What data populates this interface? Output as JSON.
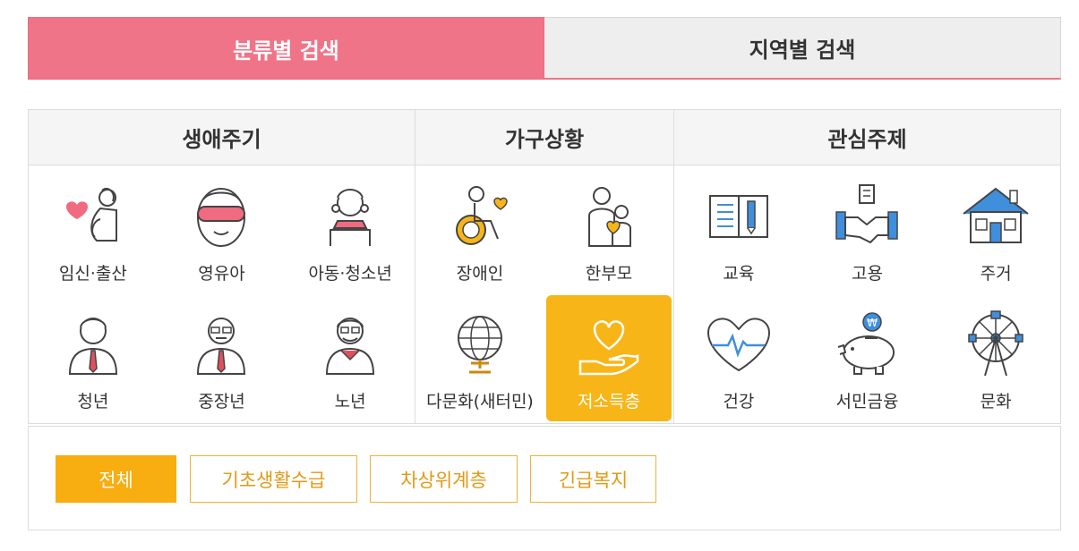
{
  "tabs": [
    {
      "label": "분류별 검색",
      "active": true
    },
    {
      "label": "지역별 검색",
      "active": false
    }
  ],
  "groups": [
    {
      "title": "생애주기",
      "items": [
        {
          "label": "임신·출산",
          "icon": "pregnant-woman-icon"
        },
        {
          "label": "영유아",
          "icon": "infant-icon"
        },
        {
          "label": "아동·청소년",
          "icon": "child-icon"
        },
        {
          "label": "청년",
          "icon": "young-man-icon"
        },
        {
          "label": "중장년",
          "icon": "middle-aged-man-icon"
        },
        {
          "label": "노년",
          "icon": "elderly-man-icon"
        }
      ]
    },
    {
      "title": "가구상황",
      "items": [
        {
          "label": "장애인",
          "icon": "wheelchair-icon"
        },
        {
          "label": "한부모",
          "icon": "single-parent-icon"
        },
        {
          "label": "다문화(새터민)",
          "icon": "globe-icon"
        },
        {
          "label": "저소득층",
          "icon": "heart-hand-icon",
          "selected": true
        }
      ]
    },
    {
      "title": "관심주제",
      "items": [
        {
          "label": "교육",
          "icon": "book-icon"
        },
        {
          "label": "고용",
          "icon": "handshake-icon"
        },
        {
          "label": "주거",
          "icon": "house-icon"
        },
        {
          "label": "건강",
          "icon": "heart-pulse-icon"
        },
        {
          "label": "서민금융",
          "icon": "piggy-bank-icon"
        },
        {
          "label": "문화",
          "icon": "ferris-wheel-icon"
        }
      ]
    }
  ],
  "filters": [
    {
      "label": "전체",
      "active": true
    },
    {
      "label": "기초생활수급",
      "active": false
    },
    {
      "label": "차상위계층",
      "active": false
    },
    {
      "label": "긴급복지",
      "active": false
    }
  ],
  "colors": {
    "tab_active": "#f07488",
    "selected": "#f8b517",
    "filter_border": "#f0b23a",
    "accent_pink": "#f06a80",
    "accent_yellow": "#f8b517",
    "accent_blue": "#3f8fdd"
  }
}
